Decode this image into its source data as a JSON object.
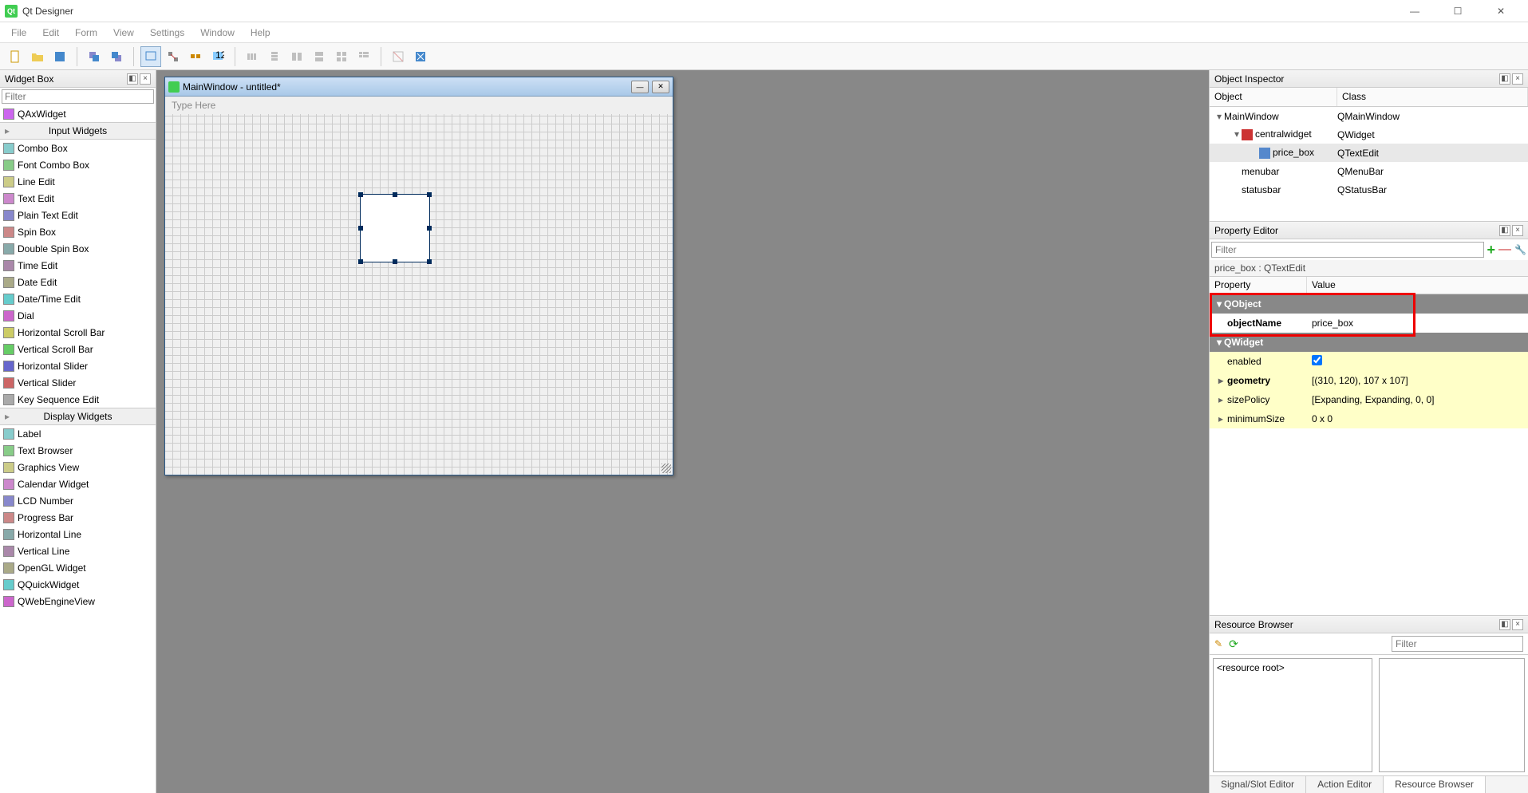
{
  "window": {
    "title": "Qt Designer"
  },
  "menubar": [
    "File",
    "Edit",
    "Form",
    "View",
    "Settings",
    "Window",
    "Help"
  ],
  "widget_box": {
    "title": "Widget Box",
    "filter_placeholder": "Filter",
    "top_item": "QAxWidget",
    "cat_input": "Input Widgets",
    "input_widgets": [
      "Combo Box",
      "Font Combo Box",
      "Line Edit",
      "Text Edit",
      "Plain Text Edit",
      "Spin Box",
      "Double Spin Box",
      "Time Edit",
      "Date Edit",
      "Date/Time Edit",
      "Dial",
      "Horizontal Scroll Bar",
      "Vertical Scroll Bar",
      "Horizontal Slider",
      "Vertical Slider",
      "Key Sequence Edit"
    ],
    "cat_display": "Display Widgets",
    "display_widgets": [
      "Label",
      "Text Browser",
      "Graphics View",
      "Calendar Widget",
      "LCD Number",
      "Progress Bar",
      "Horizontal Line",
      "Vertical Line",
      "OpenGL Widget",
      "QQuickWidget",
      "QWebEngineView"
    ]
  },
  "form_window": {
    "title": "MainWindow - untitled*",
    "menustrip": "Type Here"
  },
  "object_inspector": {
    "title": "Object Inspector",
    "head_object": "Object",
    "head_class": "Class",
    "rows": [
      {
        "indent": 0,
        "chev": "▾",
        "name": "MainWindow",
        "class": "QMainWindow"
      },
      {
        "indent": 1,
        "chev": "▾",
        "name": "centralwidget",
        "class": "QWidget",
        "icon": "#c33"
      },
      {
        "indent": 2,
        "chev": "",
        "name": "price_box",
        "class": "QTextEdit",
        "icon": "#58c",
        "sel": true
      },
      {
        "indent": 1,
        "chev": "",
        "name": "menubar",
        "class": "QMenuBar"
      },
      {
        "indent": 1,
        "chev": "",
        "name": "statusbar",
        "class": "QStatusBar"
      }
    ]
  },
  "property_editor": {
    "title": "Property Editor",
    "filter_placeholder": "Filter",
    "context": "price_box : QTextEdit",
    "head_prop": "Property",
    "head_val": "Value",
    "cat_qobject": "QObject",
    "objectName_label": "objectName",
    "objectName_value": "price_box",
    "cat_qwidget": "QWidget",
    "rows": [
      {
        "name": "enabled",
        "val": "",
        "check": true
      },
      {
        "name": "geometry",
        "val": "[(310, 120), 107 x 107]",
        "bold": true,
        "chev": true
      },
      {
        "name": "sizePolicy",
        "val": "[Expanding, Expanding, 0, 0]",
        "chev": true
      },
      {
        "name": "minimumSize",
        "val": "0 x 0",
        "chev": true
      }
    ]
  },
  "resource_browser": {
    "title": "Resource Browser",
    "root": "<resource root>",
    "filter_placeholder": "Filter"
  },
  "bottom_tabs": [
    "Signal/Slot Editor",
    "Action Editor",
    "Resource Browser"
  ]
}
